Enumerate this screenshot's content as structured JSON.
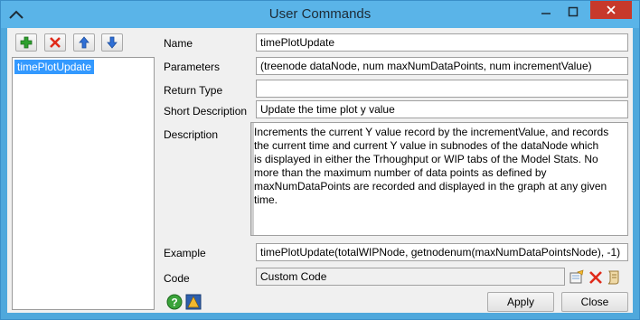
{
  "window": {
    "title": "User Commands"
  },
  "toolbar": {
    "add_icon": "plus-icon",
    "remove_icon": "x-icon",
    "up_icon": "arrow-up-icon",
    "down_icon": "arrow-down-icon"
  },
  "list": {
    "items": [
      "timePlotUpdate"
    ]
  },
  "form": {
    "name_label": "Name",
    "name_value": "timePlotUpdate",
    "parameters_label": "Parameters",
    "parameters_value": "(treenode dataNode, num maxNumDataPoints, num incrementValue)",
    "return_type_label": "Return Type",
    "return_type_value": "",
    "short_description_label": "Short Description",
    "short_description_value": "Update the time plot y value",
    "description_label": "Description",
    "description_lines": [
      "Increments the current Y value record by the incrementValue, and records",
      "the current time and current Y value in subnodes of the dataNode which",
      "is displayed in either the Trhoughput or WIP tabs of the Model Stats. No",
      "more than the maximum number of data points as defined by",
      "maxNumDataPoints are recorded and displayed in the graph at any given",
      "time."
    ],
    "example_label": "Example",
    "example_value": "timePlotUpdate(totalWIPNode, getnodenum(maxNumDataPointsNode), -1)",
    "code_label": "Code",
    "code_value": "Custom Code"
  },
  "buttons": {
    "apply": "Apply",
    "close": "Close"
  },
  "colors": {
    "titlebar": "#5ab4e8",
    "close": "#c7392b",
    "selection": "#3399ff"
  }
}
